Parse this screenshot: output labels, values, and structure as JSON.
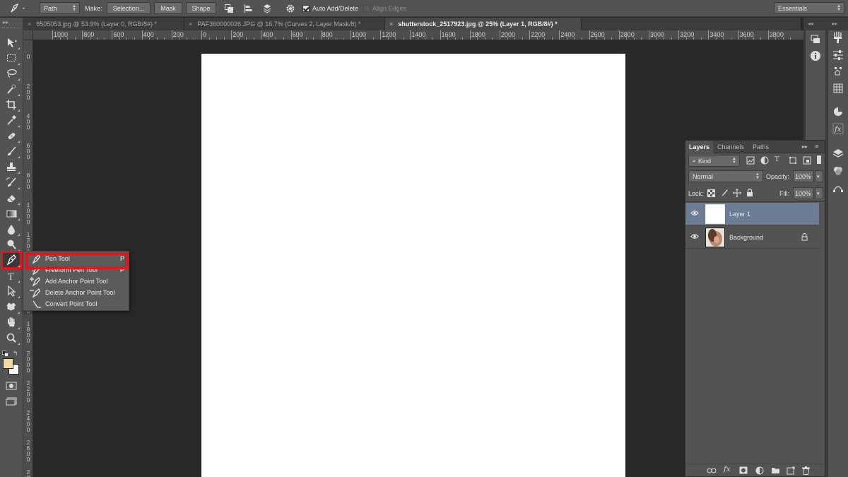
{
  "options_bar": {
    "mode_select": "Path",
    "make_label": "Make:",
    "selection_button": "Selection...",
    "mask_button": "Mask",
    "shape_button": "Shape",
    "auto_add_delete": "Auto Add/Delete",
    "auto_add_delete_checked": true,
    "align_edges": "Align Edges",
    "align_edges_checked": false,
    "workspace_select": "Essentials"
  },
  "document_tabs": [
    {
      "title": "8505053.jpg @ 53.9% (Layer 0, RGB/8#) *",
      "active": false
    },
    {
      "title": "PAF360000026.JPG @ 16.7% (Curves 2, Layer Mask/8) *",
      "active": false
    },
    {
      "title": "shutterstock_2517923.jpg @ 25% (Layer 1, RGB/8#) *",
      "active": true
    }
  ],
  "ruler_top": [
    "1000",
    "800",
    "600",
    "400",
    "200",
    "0",
    "200",
    "400",
    "600",
    "800",
    "1000",
    "1200",
    "1400",
    "1600",
    "1800",
    "2000",
    "2200",
    "2400",
    "2600",
    "2800",
    "3000",
    "3200",
    "3400",
    "3600",
    "3800"
  ],
  "ruler_left": [
    "0",
    "2 0 0",
    "4 0 0",
    "6 0 0",
    "8 0 0",
    "1 0 0 0",
    "1 2 0 0",
    "1 4 0 0",
    "1 6 0 0",
    "1 8 0 0",
    "2 0 0 0",
    "2 2 0 0",
    "2 4 0 0",
    "2 6 0 0",
    "2 8 0 0"
  ],
  "tools": [
    {
      "name": "move-tool-icon",
      "interactable": true
    },
    {
      "name": "rectangular-marquee-icon",
      "interactable": true
    },
    {
      "name": "lasso-icon",
      "interactable": true
    },
    {
      "name": "quick-selection-icon",
      "interactable": true
    },
    {
      "name": "crop-icon",
      "interactable": true
    },
    {
      "name": "eyedropper-icon",
      "interactable": true
    },
    {
      "name": "spot-healing-icon",
      "interactable": true
    },
    {
      "name": "brush-icon",
      "interactable": true
    },
    {
      "name": "clone-stamp-icon",
      "interactable": true
    },
    {
      "name": "history-brush-icon",
      "interactable": true
    },
    {
      "name": "eraser-icon",
      "interactable": true
    },
    {
      "name": "gradient-icon",
      "interactable": true
    },
    {
      "name": "blur-icon",
      "interactable": true
    },
    {
      "name": "dodge-icon",
      "interactable": true
    },
    {
      "name": "pen-tool-icon",
      "interactable": true
    },
    {
      "name": "type-tool-icon",
      "interactable": true
    },
    {
      "name": "path-selection-icon",
      "interactable": true
    },
    {
      "name": "custom-shape-icon",
      "interactable": true
    },
    {
      "name": "hand-tool-icon",
      "interactable": true
    },
    {
      "name": "zoom-tool-icon",
      "interactable": true
    }
  ],
  "flyout": {
    "items": [
      {
        "label": "Pen Tool",
        "key": "P"
      },
      {
        "label": "Freeform Pen Tool",
        "key": "P"
      },
      {
        "label": "Add Anchor Point Tool",
        "key": ""
      },
      {
        "label": "Delete Anchor Point Tool",
        "key": ""
      },
      {
        "label": "Convert Point Tool",
        "key": ""
      }
    ]
  },
  "colors": {
    "foreground": "#f0d9a2",
    "background": "#ffffff",
    "highlight": "#e8141b",
    "selected_layer": "#6b7c93"
  },
  "layers_panel": {
    "tabs": [
      "Layers",
      "Channels",
      "Paths"
    ],
    "filter_kind": "Kind",
    "blend_mode": "Normal",
    "opacity_label": "Opacity:",
    "opacity_value": "100%",
    "lock_label": "Lock:",
    "fill_label": "Fill:",
    "fill_value": "100%",
    "layers": [
      {
        "name": "Layer 1",
        "selected": true,
        "locked": false
      },
      {
        "name": "Background",
        "selected": false,
        "locked": true
      }
    ]
  }
}
